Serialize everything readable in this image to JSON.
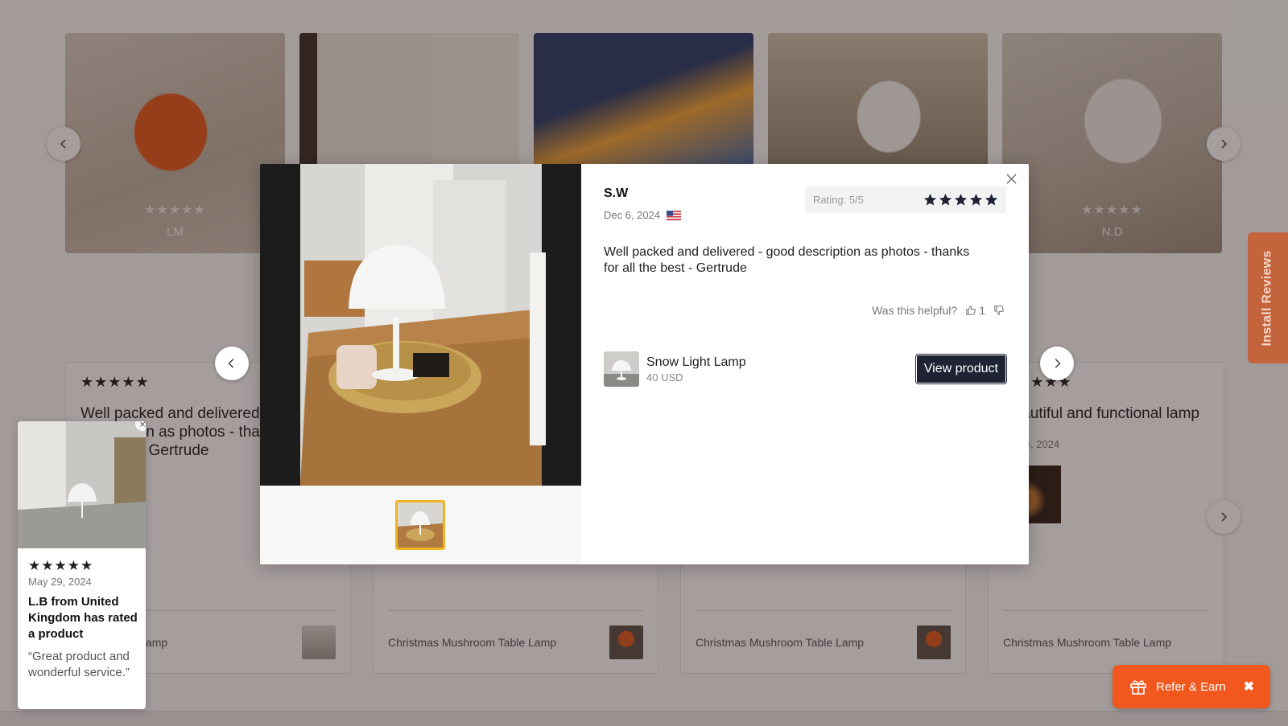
{
  "photo_carousel": {
    "cards": [
      {
        "name": "LM",
        "stars": "★★★★★"
      },
      {
        "name": "",
        "stars": ""
      },
      {
        "name": "",
        "stars": ""
      },
      {
        "name": "",
        "stars": ""
      },
      {
        "name": "N.D",
        "stars": "★★★★★"
      }
    ]
  },
  "review_cards": [
    {
      "stars": "★★★★★",
      "text": "Well packed and delivered - good description as photos - thanks for all the best - Gertrude",
      "product": "Snow Light Lamp"
    },
    {
      "stars": "",
      "text": "",
      "product": "Christmas Mushroom Table Lamp"
    },
    {
      "stars": "",
      "text": "",
      "product": "Christmas Mushroom Table Lamp"
    },
    {
      "stars": "★★★★★",
      "text": "Beautiful and functional lamp",
      "date": "Dec 4, 2024",
      "product": "Christmas Mushroom Table Lamp"
    }
  ],
  "modal": {
    "reviewer": "S.W",
    "date": "Dec 6, 2024",
    "flag": "us-flag",
    "rating_label": "Rating: 5/5",
    "rating": 5,
    "review_text": "Well packed and delivered - good description as photos - thanks for all the best - Gertrude",
    "helpful_label": "Was this helpful?",
    "helpful_up_count": "1",
    "product_name": "Snow Light Lamp",
    "product_price": "40 USD",
    "view_button": "View product"
  },
  "install_tab": "Install Reviews",
  "proof_popup": {
    "stars": "★★★★★",
    "date": "May 29, 2024",
    "title": "L.B from United Kingdom has rated a product",
    "quote": "“Great product and wonderful service.”",
    "close": "×"
  },
  "refer": {
    "label": "Refer & Earn",
    "close": "✖"
  },
  "colors": {
    "accent": "#f2571d",
    "button_dark": "#1e2433",
    "install_tab": "#c4643d",
    "thumb_border": "#f0b323"
  }
}
